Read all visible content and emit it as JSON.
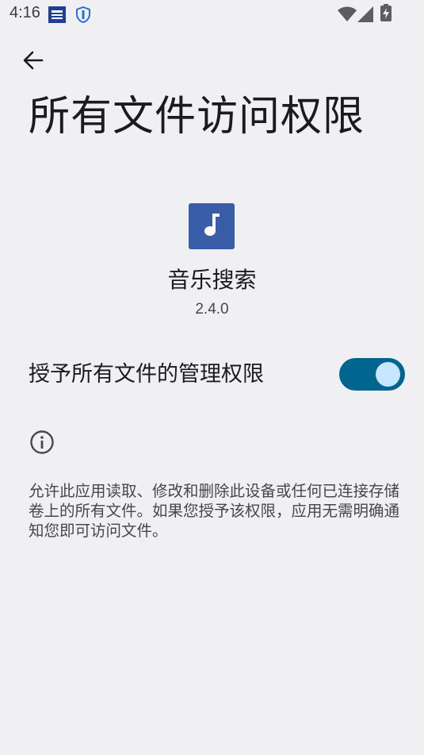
{
  "status_bar": {
    "time": "4:16",
    "icons": [
      "notification-app-icon",
      "shield-app-icon",
      "wifi-icon",
      "cellular-signal-icon",
      "battery-charging-icon"
    ]
  },
  "header": {
    "back_icon": "arrow-left-icon",
    "title": "所有文件访问权限"
  },
  "app": {
    "icon": "music-note-icon",
    "icon_color": "#3a5da8",
    "name": "音乐搜索",
    "version": "2.4.0"
  },
  "permission": {
    "label": "授予所有文件的管理权限",
    "enabled": true,
    "track_color": "#00658f",
    "thumb_color": "#c6e7ff"
  },
  "info": {
    "icon": "info-icon",
    "description": "允许此应用读取、修改和删除此设备或任何已连接存储卷上的所有文件。如果您授予该权限，应用无需明确通知您即可访问文件。"
  }
}
